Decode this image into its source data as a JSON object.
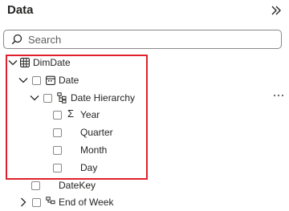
{
  "header": {
    "title": "Data"
  },
  "search": {
    "placeholder": "Search"
  },
  "tree": {
    "table": "DimDate",
    "date_field": "Date",
    "hierarchy": "Date Hierarchy",
    "levels": [
      "Year",
      "Quarter",
      "Month",
      "Day"
    ],
    "other_fields": [
      "DateKey",
      "End of Week"
    ]
  },
  "icons": {
    "collapse": "double-chevron-right-icon",
    "search": "search-icon",
    "table": "table-icon",
    "calendar": "calendar-icon",
    "hierarchy": "hierarchy-icon",
    "sigma": "sigma-icon",
    "more": "more-options-icon"
  },
  "colors": {
    "highlight": "#e0202a",
    "border": "#8a8886",
    "text": "#252423"
  }
}
